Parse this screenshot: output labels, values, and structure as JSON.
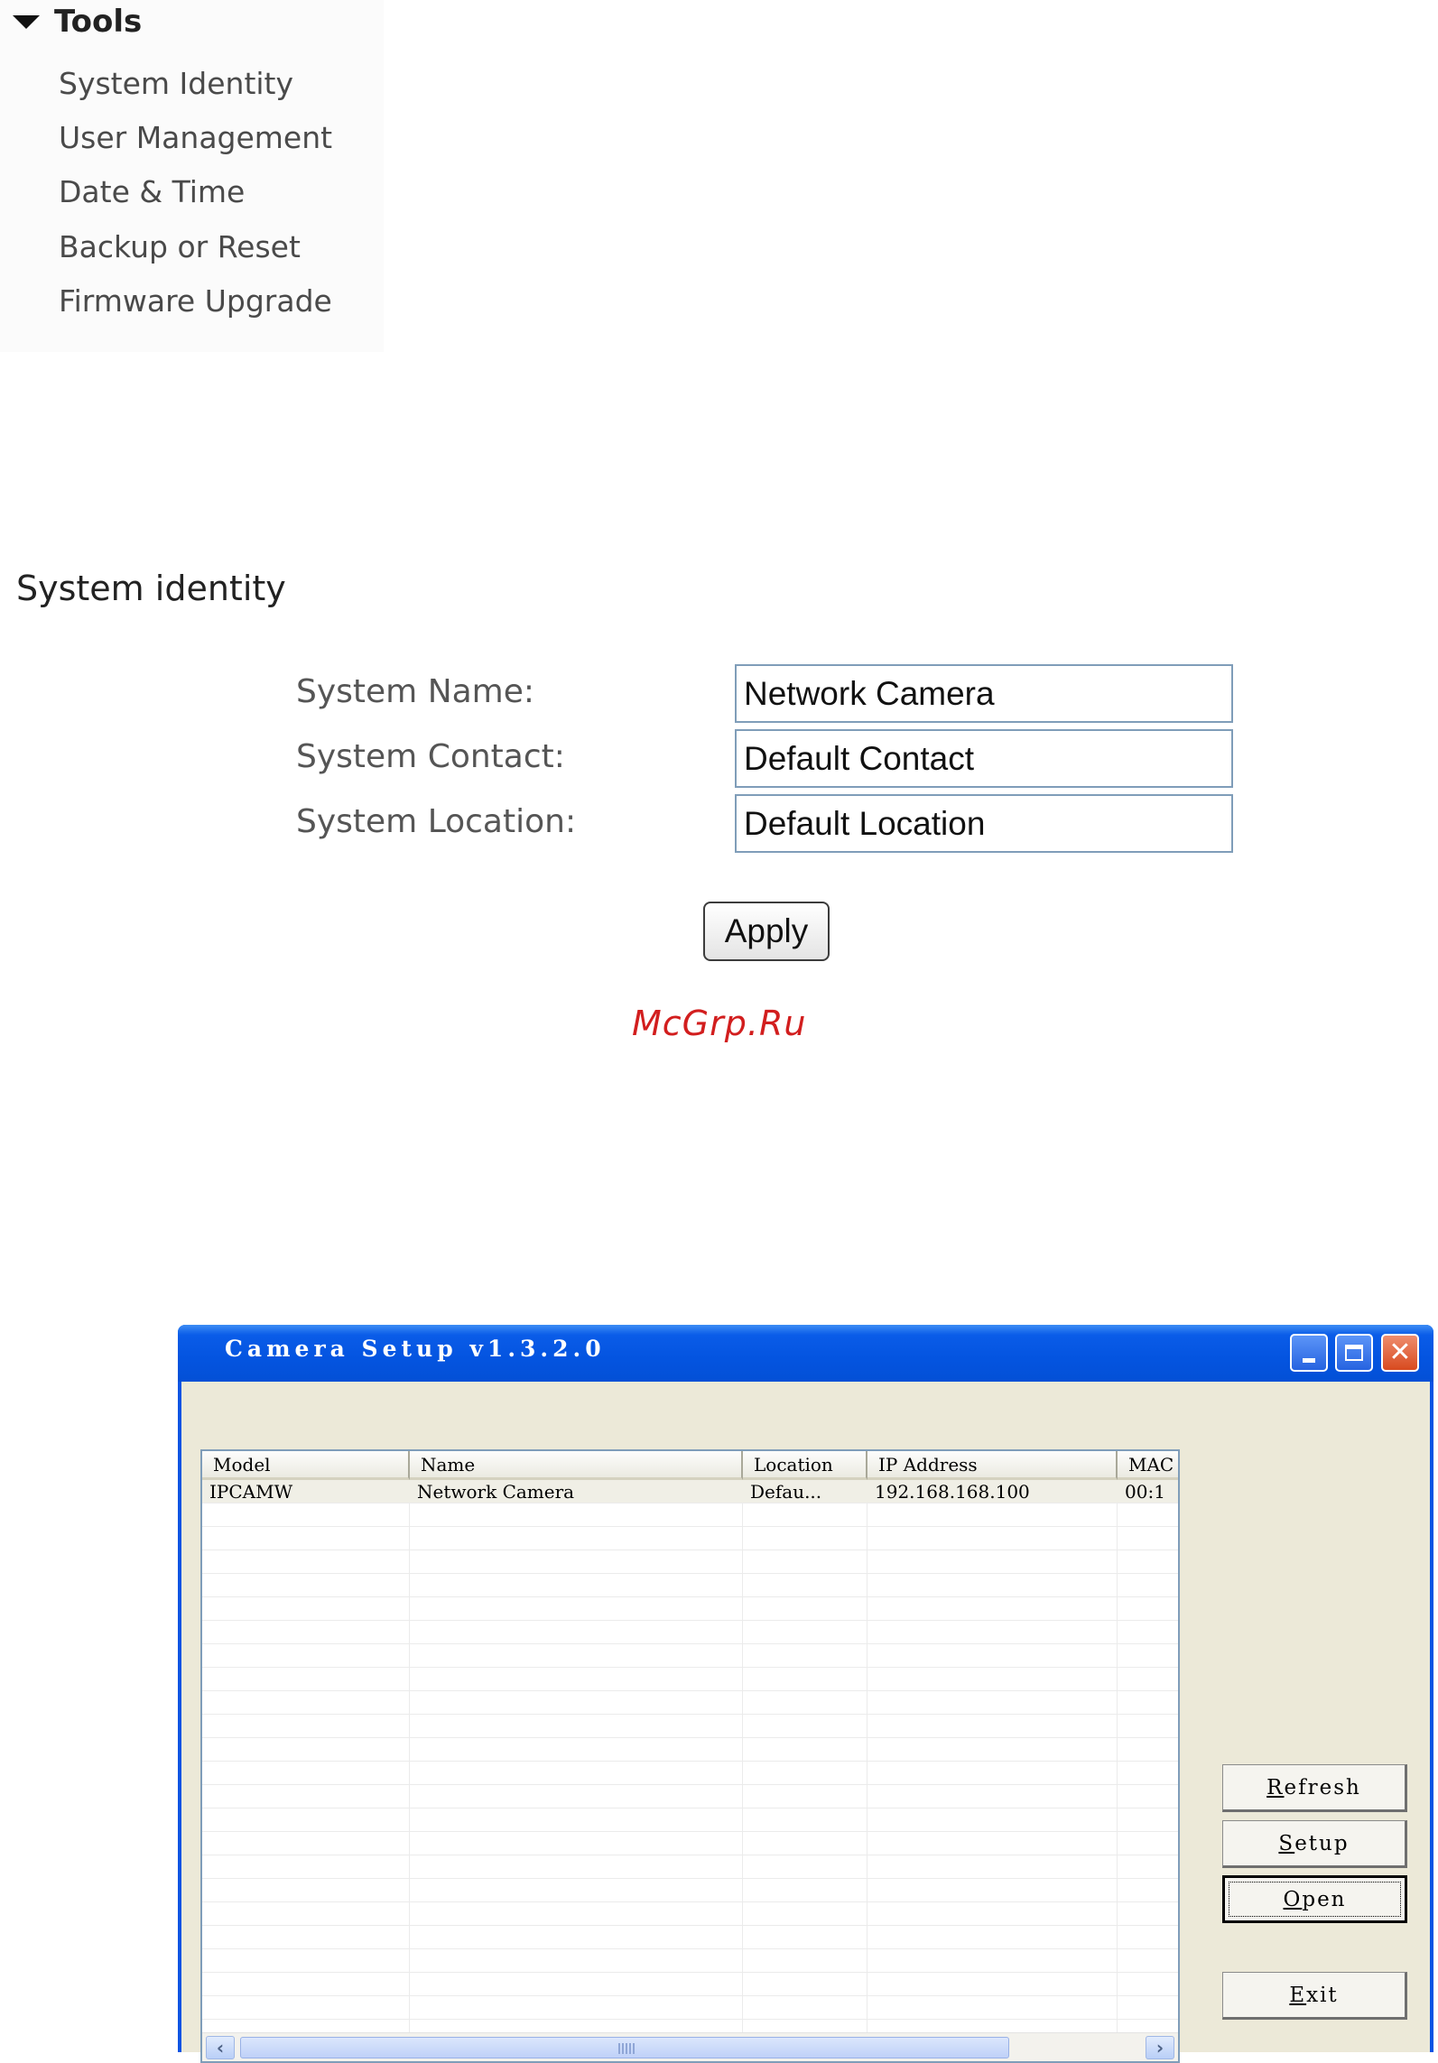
{
  "tools_menu": {
    "title": "Tools",
    "items": [
      "System Identity",
      "User Management",
      "Date & Time",
      "Backup or Reset",
      "Firmware Upgrade"
    ]
  },
  "system_identity": {
    "heading": "System identity",
    "name_label": "System Name:",
    "name_value": "Network Camera",
    "contact_label": "System Contact:",
    "contact_value": "Default Contact",
    "location_label": "System Location:",
    "location_value": "Default Location",
    "apply_label": "Apply"
  },
  "watermark": "McGrp.Ru",
  "camera_setup": {
    "title": "Camera Setup v1.3.2.0",
    "columns": [
      "Model",
      "Name",
      "Location",
      "IP Address",
      "MAC"
    ],
    "rows": [
      [
        "IPCAMW",
        "Network Camera",
        "Defau...",
        "192.168.168.100",
        "00:1"
      ]
    ],
    "buttons": {
      "refresh": "Refresh",
      "setup": "Setup",
      "open": "Open",
      "exit": "Exit"
    }
  }
}
